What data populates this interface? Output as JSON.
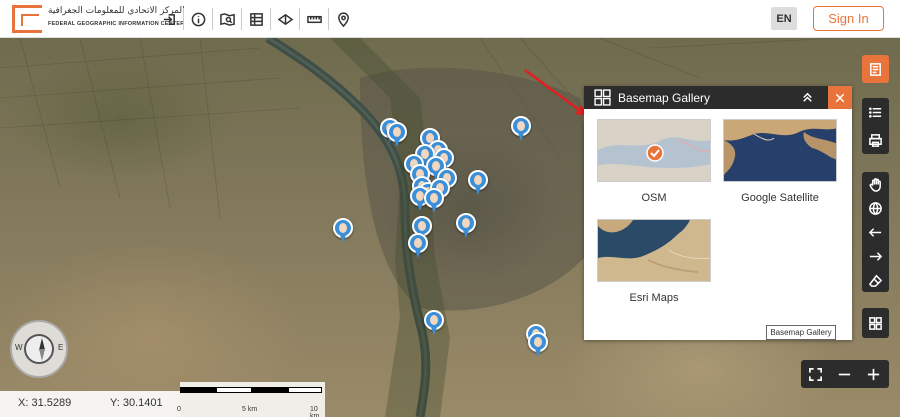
{
  "header": {
    "logo_arabic": "المركز الاتحادي للمعلومات الجغرافية",
    "logo_english": "FEDERAL GEOGRAPHIC INFORMATION CENTER",
    "tools": [
      "login-icon",
      "info-icon",
      "map-search-icon",
      "table-icon",
      "compare-icon",
      "measure-icon",
      "location-icon"
    ],
    "lang_label": "EN",
    "signin_label": "Sign In"
  },
  "basemap_gallery": {
    "title": "Basemap Gallery",
    "items": [
      {
        "label": "OSM",
        "selected": true
      },
      {
        "label": "Google Satellite",
        "selected": false
      },
      {
        "label": "Esri Maps",
        "selected": false
      }
    ],
    "tooltip": "Basemap Gallery"
  },
  "coordinates": {
    "x": "X: 31.5289",
    "y": "Y: 30.1401"
  },
  "scale": {
    "labels": [
      "0",
      "5 km",
      "10 km"
    ]
  },
  "right_toolbar": [
    "basemap-list-icon",
    "layers-list-icon",
    "print-icon",
    "pan-hand-icon",
    "globe-icon",
    "arrow-left-icon",
    "arrow-right-icon",
    "eraser-icon",
    "basemap-gallery-icon"
  ],
  "zoom_controls": [
    "fullscreen-icon",
    "zoom-out-icon",
    "zoom-in-icon"
  ],
  "colors": {
    "accent": "#e8743b",
    "toolbar_dark": "#2c2c2c",
    "pin_blue": "#3a8fd8",
    "arrow_red": "#e02020"
  }
}
